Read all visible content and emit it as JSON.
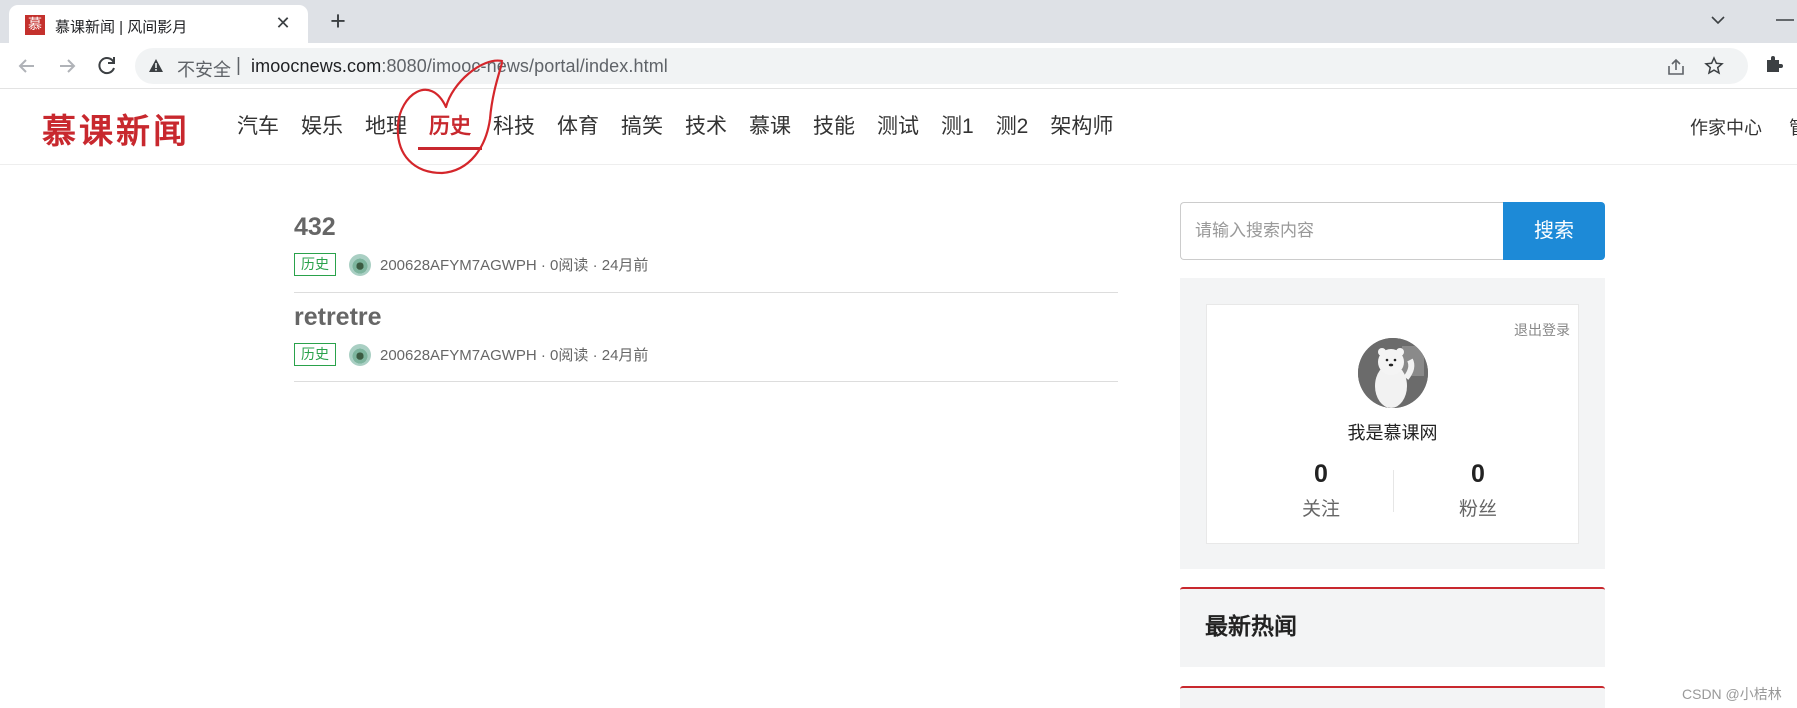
{
  "browser": {
    "tab_title": "慕课新闻 | 风间影月",
    "tab_favicon_char": "慕",
    "tab_close": "✕",
    "new_tab": "+",
    "insecure_label": "不安全",
    "separator": "|",
    "url_host": "imoocnews.com",
    "url_rest": ":8080/imooc-news/portal/index.html"
  },
  "site": {
    "logo": "慕课新闻",
    "nav": [
      {
        "label": "汽车",
        "active": false
      },
      {
        "label": "娱乐",
        "active": false
      },
      {
        "label": "地理",
        "active": false
      },
      {
        "label": "历史",
        "active": true
      },
      {
        "label": "科技",
        "active": false
      },
      {
        "label": "体育",
        "active": false
      },
      {
        "label": "搞笑",
        "active": false
      },
      {
        "label": "技术",
        "active": false
      },
      {
        "label": "慕课",
        "active": false
      },
      {
        "label": "技能",
        "active": false
      },
      {
        "label": "测试",
        "active": false
      },
      {
        "label": "测1",
        "active": false
      },
      {
        "label": "测2",
        "active": false
      },
      {
        "label": "架构师",
        "active": false
      }
    ],
    "author_center": "作家中心",
    "manage_cut": "管"
  },
  "articles": [
    {
      "title": "432",
      "tag": "历史",
      "meta": "200628AFYM7AGWPH · 0阅读 · 24月前"
    },
    {
      "title": "retretre",
      "tag": "历史",
      "meta": "200628AFYM7AGWPH · 0阅读 · 24月前"
    }
  ],
  "search": {
    "placeholder": "请输入搜索内容",
    "button": "搜索"
  },
  "profile": {
    "logout": "退出登录",
    "nickname": "我是慕课网",
    "follow_count": "0",
    "follow_label": "关注",
    "fans_count": "0",
    "fans_label": "粉丝"
  },
  "hot_news": {
    "title": "最新热闻"
  },
  "watermark": "CSDN @小桔林",
  "colors": {
    "brand_red": "#c8282e",
    "search_blue": "#1d8ad7",
    "tag_green": "#2aa24b"
  }
}
